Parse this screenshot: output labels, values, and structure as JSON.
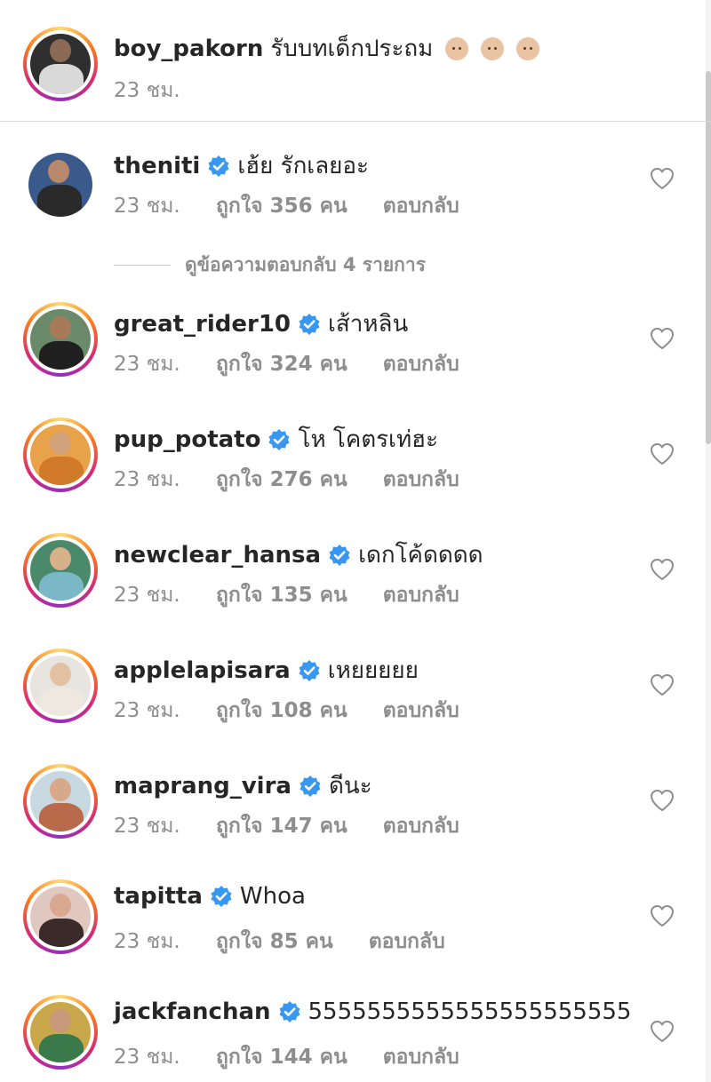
{
  "caption": {
    "username": "boy_pakorn",
    "text": "รับบทเด็กประถม",
    "emoji_icons": [
      "baby-face-icon",
      "baby-face-icon",
      "baby-face-icon"
    ],
    "time": "23 ชม."
  },
  "view_replies_label": "ดูข้อความตอบกลับ 4 รายการ",
  "reply_label": "ตอบกลับ",
  "comments": [
    {
      "username": "theniti",
      "verified": true,
      "text": "เฮ้ย รักเลยอะ",
      "time": "23 ชม.",
      "likes": "ถูกใจ 356 คน"
    },
    {
      "username": "great_rider10",
      "verified": true,
      "text": "เส้าหลิน",
      "time": "23 ชม.",
      "likes": "ถูกใจ 324 คน"
    },
    {
      "username": "pup_potato",
      "verified": true,
      "text": "โห โคตรเท่ฮะ",
      "time": "23 ชม.",
      "likes": "ถูกใจ 276 คน"
    },
    {
      "username": "newclear_hansa",
      "verified": true,
      "text": "เดกโค้ดดดด",
      "time": "23 ชม.",
      "likes": "ถูกใจ 135 คน"
    },
    {
      "username": "applelapisara",
      "verified": true,
      "text": "เหยยยยย",
      "time": "23 ชม.",
      "likes": "ถูกใจ 108 คน"
    },
    {
      "username": "maprang_vira",
      "verified": true,
      "text": "ดีนะ",
      "time": "23 ชม.",
      "likes": "ถูกใจ 147 คน"
    },
    {
      "username": "tapitta",
      "verified": true,
      "text": "Whoa",
      "time": "23 ชม.",
      "likes": "ถูกใจ 85 คน"
    },
    {
      "username": "jackfanchan",
      "verified": true,
      "text": "5555555555555555555555",
      "time": "23 ชม.",
      "likes": "ถูกใจ 144 คน"
    }
  ],
  "colors": {
    "text": "#262626",
    "secondary": "#8e8e8e",
    "verified_blue": "#3897f0",
    "divider": "#dbdbdb"
  }
}
